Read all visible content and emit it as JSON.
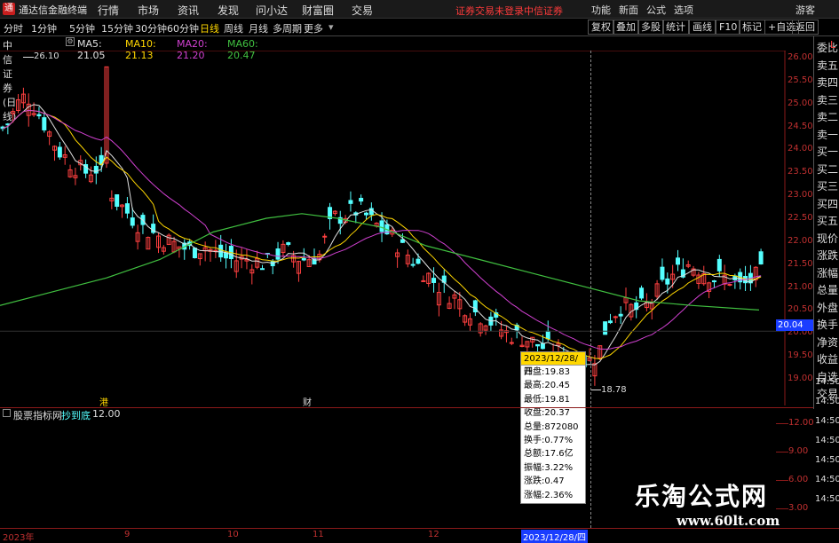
{
  "titlebar": {
    "app": "通达信金融终端",
    "menu": [
      "行情",
      "市场",
      "资讯",
      "发现",
      "问小达",
      "财富圈",
      "交易"
    ],
    "warning": "证券交易未登录",
    "broker": "中信证券",
    "right": [
      "功能",
      "新面",
      "公式",
      "选项"
    ],
    "guest": "游客"
  },
  "toolbar": {
    "periods": [
      "分时",
      "1分钟",
      "5分钟",
      "15分钟",
      "30分钟",
      "60分钟",
      "日线",
      "周线",
      "月线",
      "多周期",
      "更多"
    ],
    "selected": "日线",
    "right": [
      "复权",
      "叠加",
      "多股",
      "统计",
      "画线",
      "F10",
      "标记",
      "+自选",
      "返回"
    ]
  },
  "info": {
    "stock": "中信证券(日线)",
    "ma5": "MA5: 21.05",
    "ma10": "MA10: 21.13",
    "ma20": "MA20: 21.20",
    "ma60": "MA60: 20.47"
  },
  "right_strip": [
    "委比",
    "卖五",
    "卖四",
    "卖三",
    "卖二",
    "卖一",
    "买一",
    "买二",
    "买三",
    "买四",
    "买五",
    "现价",
    "涨跌",
    "涨幅",
    "总量",
    "外盘",
    "换手",
    "净资",
    "收益",
    "自选",
    "交易"
  ],
  "price_axis": [
    "26.00",
    "25.50",
    "25.00",
    "24.50",
    "24.00",
    "23.50",
    "23.00",
    "22.50",
    "22.00",
    "21.50",
    "21.00",
    "20.50",
    "20.00",
    "19.50",
    "19.00"
  ],
  "current_price": "20.04",
  "strip_times": [
    "14:50",
    "14:50",
    "14:50",
    "14:50",
    "14:50",
    "14:50",
    "14:50"
  ],
  "annotations": {
    "high": "26.10",
    "low": "18.78",
    "marker1": "港",
    "marker2": "财"
  },
  "tooltip": {
    "date": "2023/12/28/四",
    "rows": [
      "开盘:19.83",
      "最高:20.45",
      "最低:19.81",
      "收盘:20.37",
      "总量:872080",
      "换手:0.77%",
      "总额:17.6亿",
      "振幅:3.22%",
      "涨跌:0.47",
      "涨幅:2.36%"
    ]
  },
  "indicator": {
    "name": "股票指标网",
    "sub": "抄到底",
    "value": "12.00",
    "axis": [
      "12.00",
      "9.00",
      "6.00",
      "3.00"
    ]
  },
  "xaxis": [
    "2023年",
    "9",
    "10",
    "11",
    "12",
    "2023/12/28/四"
  ],
  "watermark": {
    "line1": "乐淘公式网",
    "line2": "www.60lt.com"
  },
  "colors": {
    "up": "#ff4040",
    "down": "#54ffff",
    "ma5": "#e0e0e0",
    "ma10": "#ffd700",
    "ma20": "#d040d0",
    "ma60": "#40c040"
  }
}
